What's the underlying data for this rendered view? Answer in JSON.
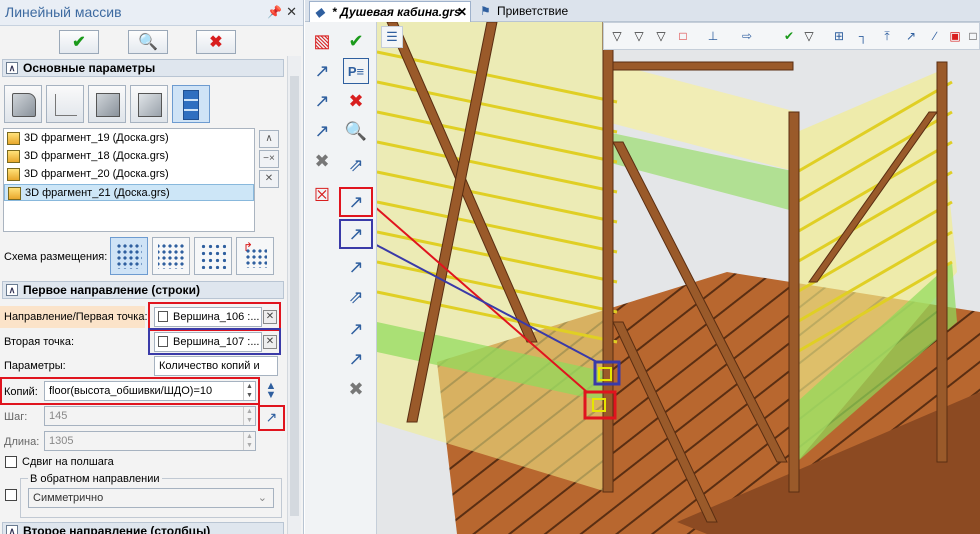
{
  "panel": {
    "title": "Линейный массив",
    "pin_icon": "pin-icon",
    "close_icon": "close-icon"
  },
  "actions": {
    "ok_icon": "checkmark-icon",
    "preview_icon": "preview-icon",
    "cancel_icon": "cancel-icon"
  },
  "sections": {
    "main": "Основные параметры",
    "first": "Первое направление (строки)",
    "second": "Второе направление (столбцы)"
  },
  "fragments": [
    "3D фрагмент_19 (Доска.grs)",
    "3D фрагмент_18 (Доска.grs)",
    "3D фрагмент_20 (Доска.grs)",
    "3D фрагмент_21 (Доска.grs)"
  ],
  "layout": {
    "label": "Схема размещения:"
  },
  "first_direction": {
    "direction_label": "Направление/Первая точка:",
    "direction_value": "Вершина_106 :...",
    "second_point_label": "Вторая точка:",
    "second_point_value": "Вершина_107 :...",
    "params_label": "Параметры:",
    "params_value": "Количество копий и",
    "copies_label": "Копий:",
    "copies_value": "floor(высота_обшивки/ШДО)=10",
    "step_label": "Шаг:",
    "step_value": "145",
    "length_label": "Длина:",
    "length_value": "1305",
    "half_step_label": "Сдвиг на полшага",
    "reverse_label": "В обратном направлении",
    "reverse_value": "Симметрично"
  },
  "tabs": {
    "doc": "* Душевая кабина.grs",
    "welcome": "Приветствие"
  },
  "colors": {
    "accent": "#3d6aa0",
    "highlight_red": "#e0141e",
    "highlight_blue": "#3a3aa8",
    "wood": "#a85a2a",
    "yellow_glass": "#f3ee8a",
    "green_glass": "#8fdc5a"
  }
}
